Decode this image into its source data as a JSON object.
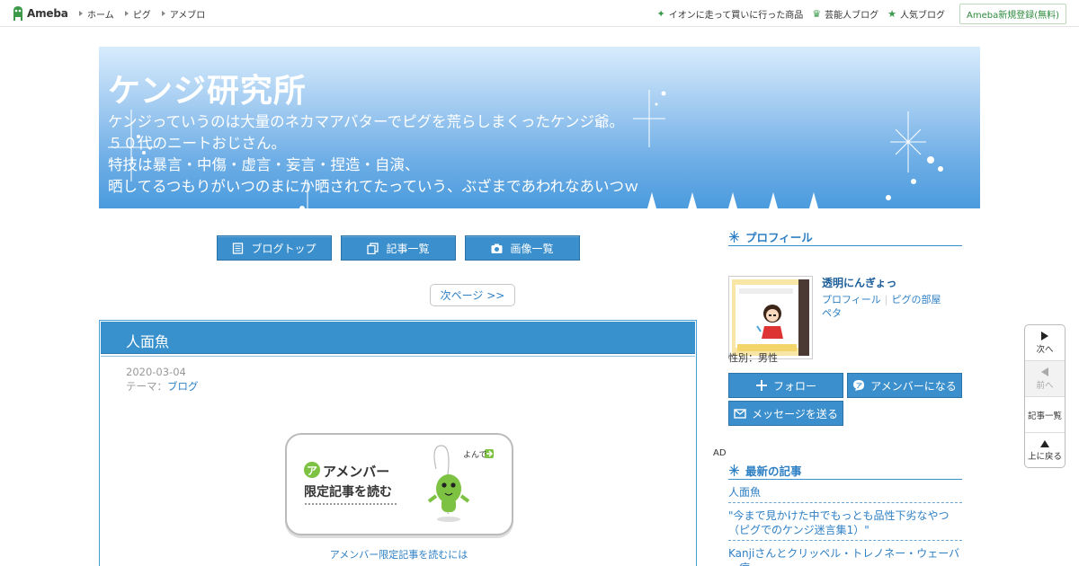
{
  "topbar": {
    "logo": "Ameba",
    "nav": [
      "ホーム",
      "ピグ",
      "アメブロ"
    ],
    "right_links": [
      {
        "icon": "sparkle-icon",
        "label": "イオンに走って買いに行った商品"
      },
      {
        "icon": "crown-icon",
        "label": "芸能人ブログ"
      },
      {
        "icon": "star-icon",
        "label": "人気ブログ"
      }
    ],
    "register": "Ameba新規登録(無料)"
  },
  "banner": {
    "title": "ケンジ研究所",
    "desc": [
      "ケンジっていうのは大量のネカマアバターでピグを荒らしまくったケンジ爺。",
      "５０代のニートおじさん。",
      "特技は暴言・中傷・虚言・妄言・捏造・自演、",
      "晒してるつもりがいつのまにか晒されてたっていう、ぶざまであわれなあいつｗ"
    ]
  },
  "blognav": {
    "top": "ブログトップ",
    "entries": "記事一覧",
    "images": "画像一覧"
  },
  "pager": {
    "next": "次ページ >>"
  },
  "article": {
    "title": "人面魚",
    "date": "2020-03-04",
    "theme_label": "テーマ：",
    "theme": "ブログ",
    "amember_title": "アメンバー",
    "amember_cta": "限定記事を読む",
    "amember_bubble": "よんで",
    "amember_link": "アメンバー限定記事を読むには"
  },
  "sidebar": {
    "profile_heading": "プロフィール",
    "name": "透明にんぎょっ",
    "link_profile": "プロフィール",
    "link_room": "ピグの部屋",
    "link_peta": "ペタ",
    "gender": "性別：男性",
    "follow": "フォロー",
    "amember": "アメンバーになる",
    "message": "メッセージを送る",
    "ad": "AD",
    "latest_heading": "最新の記事",
    "latest": [
      "人面魚",
      "\"今まで見かけた中でもっとも品性下劣なやつ（ピグでのケンジ迷言集1）\"",
      "Kanjiさんとクリッペル・トレノネー・ウェーバー症"
    ]
  },
  "floatnav": {
    "next": "次へ",
    "prev": "前へ",
    "list": "記事一覧",
    "top": "上に戻る"
  },
  "colors": {
    "accent": "#3891cd",
    "link": "#2d7fc4",
    "brand_green": "#3a9a4a"
  }
}
